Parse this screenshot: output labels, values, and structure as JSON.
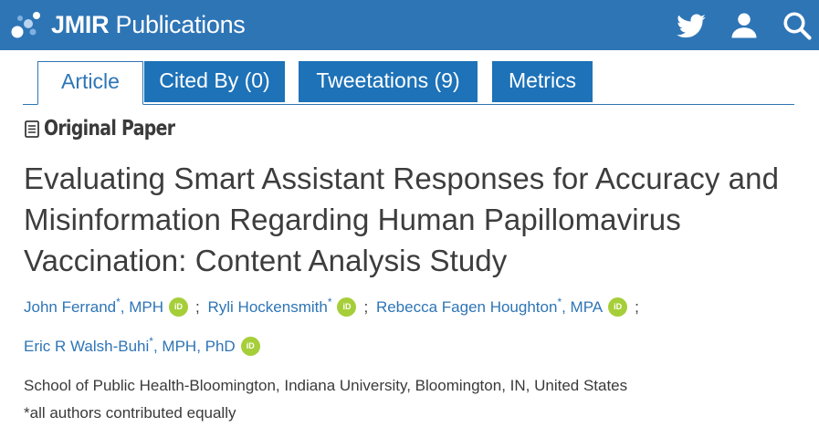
{
  "header": {
    "brand_strong": "JMIR",
    "brand_light": "Publications",
    "icons": [
      "twitter-icon",
      "user-icon",
      "search-icon"
    ],
    "colors": {
      "bar": "#2e75b6",
      "tab": "#1d72b8",
      "orcid": "#a6ce39"
    }
  },
  "tabs": [
    {
      "label": "Article",
      "active": true
    },
    {
      "label": "Cited By (0)",
      "active": false
    },
    {
      "label": "Tweetations (9)",
      "active": false
    },
    {
      "label": "Metrics",
      "active": false
    }
  ],
  "paper_type": "Original Paper",
  "title": "Evaluating Smart Assistant Responses for Accuracy and Misinformation Regarding Human Papillomavirus Vaccination: Content Analysis Study",
  "authors": [
    {
      "name": "John Ferrand",
      "star": "*",
      "credential": ", MPH"
    },
    {
      "name": "Ryli Hockensmith",
      "star": "*",
      "credential": ""
    },
    {
      "name": "Rebecca Fagen Houghton",
      "star": "*",
      "credential": ", MPA"
    },
    {
      "name": "Eric R Walsh-Buhi",
      "star": "*",
      "credential": ", MPH, PhD"
    }
  ],
  "separator": ";",
  "orcid_label": "iD",
  "affiliation": "School of Public Health-Bloomington, Indiana University, Bloomington, IN, United States",
  "note": "*all authors contributed equally"
}
